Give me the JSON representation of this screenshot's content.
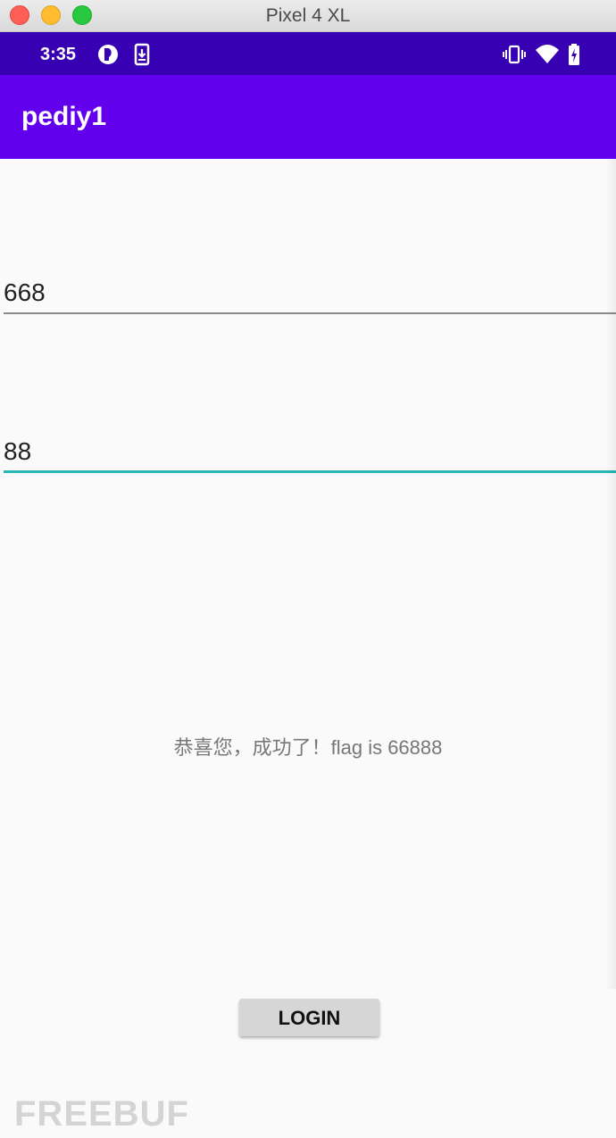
{
  "window": {
    "title": "Pixel 4 XL"
  },
  "status_bar": {
    "time": "3:35",
    "left_icons": [
      "notification-badge-icon",
      "download-icon"
    ],
    "right_icons": [
      "vibrate-icon",
      "wifi-icon",
      "battery-charging-icon"
    ]
  },
  "app_bar": {
    "title": "pediy1"
  },
  "form": {
    "field1_value": "668",
    "field2_value": "88",
    "result": "恭喜您，成功了！flag is 66888",
    "login_label": "LOGIN"
  },
  "watermark": "FREEBUF",
  "colors": {
    "status_bar": "#3700b3",
    "app_bar": "#6200ee",
    "focus_underline": "#29b6b6"
  }
}
